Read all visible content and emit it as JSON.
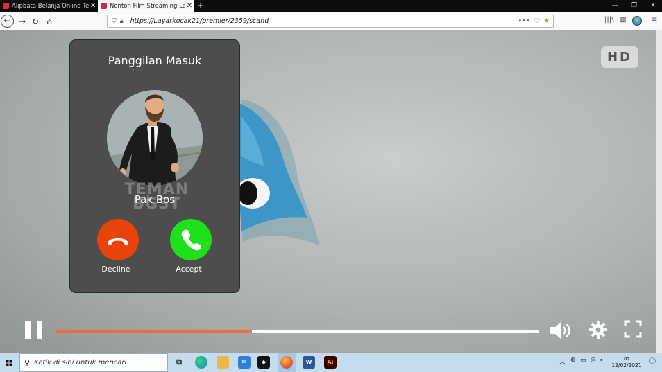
{
  "browser": {
    "tabs": [
      {
        "title": "Alipbata Belanja Online Ter",
        "favicon_color": "#e02a35",
        "favicon_letter": "a",
        "active": false
      },
      {
        "title": "Nonton Film Streaming Layar",
        "favicon_color": "#c92a4c",
        "favicon_letter": "S",
        "active": true
      }
    ],
    "url": "https://Layarkocak21/premier/2359/scand"
  },
  "video": {
    "quality_badge": "HD",
    "progress_fraction": 0.405
  },
  "call": {
    "title": "Panggilan Masuk",
    "watermark": "TEMAN BGST",
    "caller_name": "Pak Bos",
    "decline_label": "Decline",
    "accept_label": "Accept",
    "decline_color": "#e8430a",
    "accept_color": "#1fe01b"
  },
  "taskbar": {
    "search_placeholder": "Ketik di sini untuk mencari",
    "date": "12/02/2021",
    "apps": [
      "task-view",
      "edge",
      "file-explorer",
      "mail",
      "unity",
      "firefox",
      "word",
      "illustrator"
    ]
  }
}
